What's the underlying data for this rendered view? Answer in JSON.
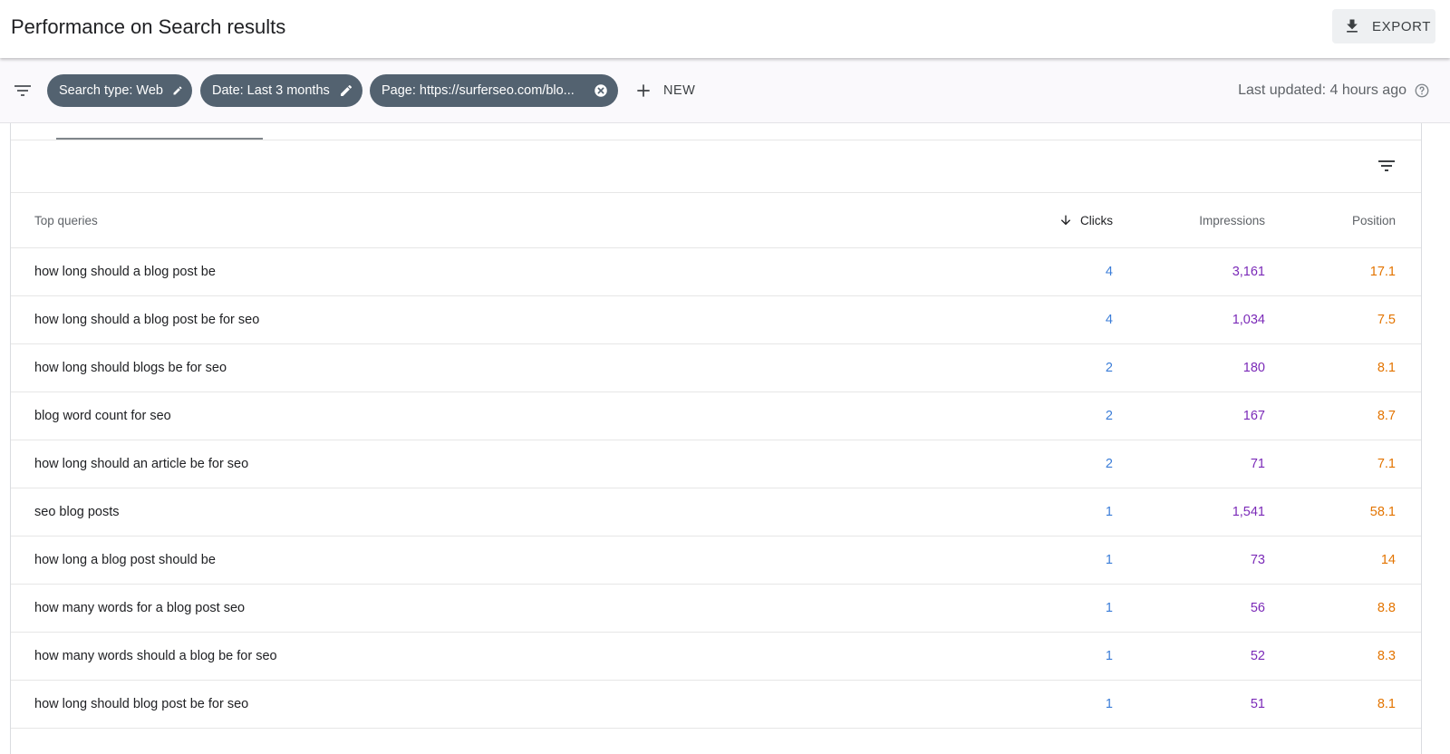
{
  "header": {
    "title": "Performance on Search results",
    "export_label": "EXPORT"
  },
  "filters": {
    "chips": [
      {
        "label": "Search type: Web",
        "action": "edit-icon"
      },
      {
        "label": "Date: Last 3 months",
        "action": "edit-icon"
      },
      {
        "label": "Page: https://surferseo.com/blo...",
        "action": "close-circle-icon"
      }
    ],
    "new_label": "NEW",
    "last_updated": "Last updated: 4 hours ago"
  },
  "table": {
    "headers": {
      "query": "Top queries",
      "clicks": "Clicks",
      "impressions": "Impressions",
      "position": "Position"
    },
    "sort": {
      "column": "clicks",
      "direction": "descending"
    },
    "rows": [
      {
        "query": "how long should a blog post be",
        "clicks": "4",
        "impressions": "3,161",
        "position": "17.1"
      },
      {
        "query": "how long should a blog post be for seo",
        "clicks": "4",
        "impressions": "1,034",
        "position": "7.5"
      },
      {
        "query": "how long should blogs be for seo",
        "clicks": "2",
        "impressions": "180",
        "position": "8.1"
      },
      {
        "query": "blog word count for seo",
        "clicks": "2",
        "impressions": "167",
        "position": "8.7"
      },
      {
        "query": "how long should an article be for seo",
        "clicks": "2",
        "impressions": "71",
        "position": "7.1"
      },
      {
        "query": "seo blog posts",
        "clicks": "1",
        "impressions": "1,541",
        "position": "58.1"
      },
      {
        "query": "how long a blog post should be",
        "clicks": "1",
        "impressions": "73",
        "position": "14"
      },
      {
        "query": "how many words for a blog post seo",
        "clicks": "1",
        "impressions": "56",
        "position": "8.8"
      },
      {
        "query": "how many words should a blog be for seo",
        "clicks": "1",
        "impressions": "52",
        "position": "8.3"
      },
      {
        "query": "how long should blog post be for seo",
        "clicks": "1",
        "impressions": "51",
        "position": "8.1"
      }
    ]
  },
  "colors": {
    "chip_bg": "#536270",
    "clicks": "#3b7dd8",
    "impressions": "#7b2ab8",
    "position": "#e37400"
  }
}
